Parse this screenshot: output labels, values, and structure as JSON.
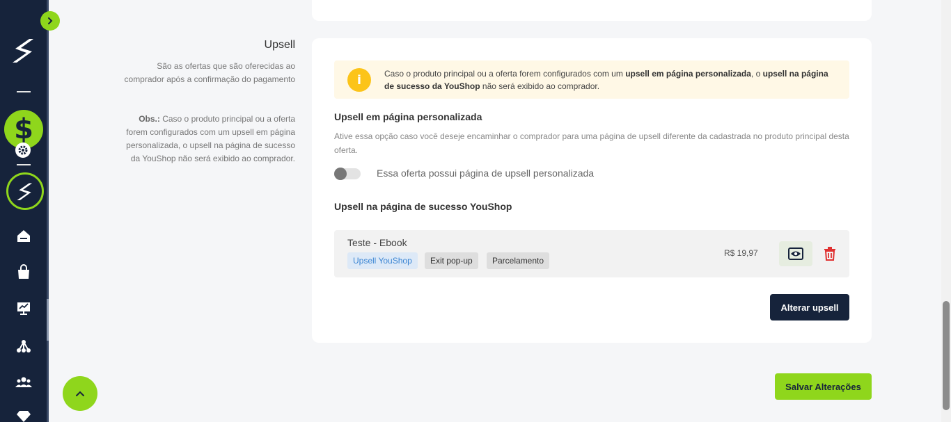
{
  "sidebar": {
    "expand_icon": "chevron-right-icon",
    "money_symbol": "$",
    "colors": {
      "background": "#16233b",
      "accent": "#8fd61c"
    },
    "nav_icons": [
      "home-icon",
      "shopping-bag-icon",
      "dashboard-chart-icon",
      "affiliates-network-icon",
      "users-group-icon",
      "diamond-icon"
    ]
  },
  "upsell_section": {
    "title": "Upsell",
    "description": "São as ofertas que são oferecidas ao comprador após a confirmação do pagamento",
    "obs_label": "Obs.:",
    "obs_text": " Caso o produto principal ou a oferta forem configurados com um upsell em página personalizada, o upsell na página de sucesso da YouShop não será exibido ao comprador."
  },
  "alert": {
    "icon": "info-icon",
    "text_part1": "Caso o produto principal ou a oferta forem configurados com um ",
    "bold1": "upsell em página personalizada",
    "text_part2": ", o ",
    "bold2": "upsell na página de sucesso da YouShop",
    "text_part3": " não será exibido ao comprador."
  },
  "custom_page": {
    "heading": "Upsell em página personalizada",
    "help": "Ative essa opção caso você deseje encaminhar o comprador para uma página de upsell diferente da cadastrada no produto principal desta oferta.",
    "toggle_label": "Essa oferta possui página de upsell personalizada",
    "toggle_on": false
  },
  "success_page": {
    "heading": "Upsell na página de sucesso YouShop",
    "offer": {
      "name": "Teste - Ebook",
      "tags": [
        "Upsell YouShop",
        "Exit pop-up",
        "Parcelamento"
      ],
      "price": "R$ 19,97"
    }
  },
  "buttons": {
    "alter_upsell": "Alterar upsell",
    "save_changes": "Salvar Alterações"
  }
}
